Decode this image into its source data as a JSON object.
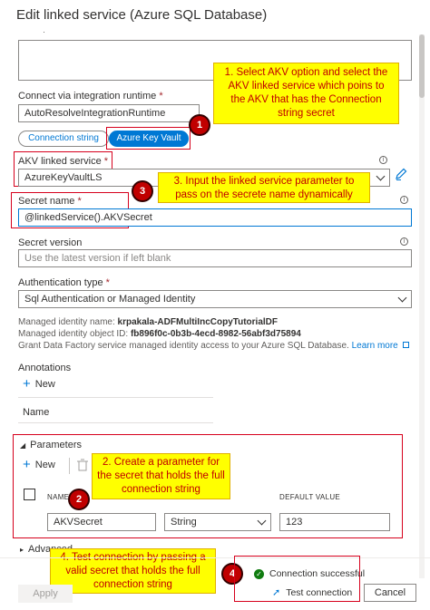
{
  "dialog": {
    "title": "Edit linked service (Azure SQL Database)"
  },
  "description": {
    "label_fragment": "·"
  },
  "runtime": {
    "label": "Connect via integration runtime",
    "required": "*",
    "value": "AutoResolveIntegrationRuntime"
  },
  "auth_toggle": {
    "option_a": "Connection string",
    "option_b": "Azure Key Vault"
  },
  "akv": {
    "label": "AKV linked service",
    "required": "*",
    "value": "AzureKeyVaultLS"
  },
  "secret_name": {
    "label": "Secret name",
    "required": "*",
    "value": "@linkedService().AKVSecret"
  },
  "secret_version": {
    "label": "Secret version",
    "placeholder": "Use the latest version if left blank"
  },
  "auth_type": {
    "label": "Authentication type",
    "required": "*",
    "value": "Sql Authentication or Managed Identity"
  },
  "managed_identity": {
    "name_label": "Managed identity name: ",
    "name_value": "krpakala-ADFMultiIncCopyTutorialDF",
    "id_label": "Managed identity object ID: ",
    "id_value": "fb896f0c-0b3b-4ecd-8982-56abf3d75894",
    "grant_text": "Grant Data Factory service managed identity access to your Azure SQL Database.",
    "learn_more": "Learn more"
  },
  "annotations": {
    "heading": "Annotations",
    "new_label": "New",
    "col_name": "Name"
  },
  "parameters": {
    "heading": "Parameters",
    "new_label": "New",
    "col_name": "NAME",
    "col_default": "DEFAULT VALUE",
    "row": {
      "name": "AKVSecret",
      "type": "String",
      "default": "123"
    }
  },
  "advanced": {
    "label": "Advanced"
  },
  "footer": {
    "apply": "Apply",
    "status": "Connection successful",
    "test": "Test connection",
    "cancel": "Cancel"
  },
  "callouts": {
    "c1": "1. Select AKV option and select the AKV linked service which poins to the AKV that has the Connection string secret",
    "c2": "2. Create a parameter for the secret that holds the full connection string",
    "c3": "3. Input the linked service parameter to pass on the secrete name dynamically",
    "c4": "4. Test connection by passing a valid secret that holds the full connection string"
  },
  "badges": {
    "b1": "1",
    "b2": "2",
    "b3": "3",
    "b4": "4"
  },
  "icons": {
    "info": "i"
  },
  "colors": {
    "accent": "#0078d4",
    "callout_bg": "#ffff00",
    "callout_text": "#c00000",
    "success": "#107c10",
    "redbox": "#d6001c"
  }
}
